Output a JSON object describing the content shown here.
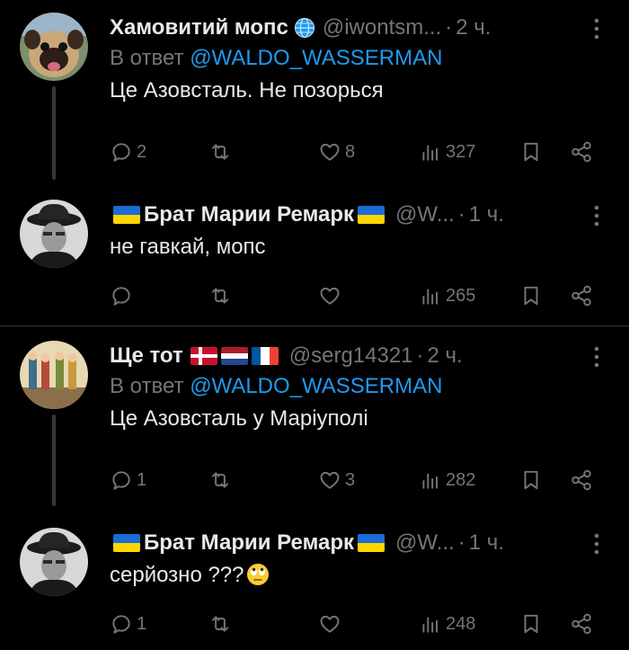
{
  "colors": {
    "background": "#000000",
    "text": "#e7e9ea",
    "muted": "#71767b",
    "link": "#1d9bf0"
  },
  "tweets": [
    {
      "name": "Хамовитий мопс",
      "badge_icon": "globe-icon",
      "handle": "@iwontsm...",
      "time": "2 ч.",
      "reply_prefix": "В ответ",
      "reply_to": "@WALDO_WASSERMAN",
      "text": "Це Азовсталь. Не позорься",
      "replies": "2",
      "retweets": "",
      "likes": "8",
      "views": "327"
    },
    {
      "name": "Брат Марии Ремарк",
      "badge_icon": "ukraine-flag-icon",
      "handle": "@W...",
      "time": "1 ч.",
      "text": "не гавкай, мопс",
      "replies": "",
      "retweets": "",
      "likes": "",
      "views": "265"
    },
    {
      "name": "Ще тот",
      "badge_icon": "flags-icon",
      "handle": "@serg14321",
      "time": "2 ч.",
      "reply_prefix": "В ответ",
      "reply_to": "@WALDO_WASSERMAN",
      "text": "Це Азовсталь у Маріуполі",
      "replies": "1",
      "retweets": "",
      "likes": "3",
      "views": "282"
    },
    {
      "name": "Брат Марии Ремарк",
      "badge_icon": "ukraine-flag-icon",
      "handle": "@W...",
      "time": "1 ч.",
      "text": "серйозно ???",
      "text_emoji": "rolling-eyes-emoji",
      "replies": "1",
      "retweets": "",
      "likes": "",
      "views": "248"
    }
  ]
}
